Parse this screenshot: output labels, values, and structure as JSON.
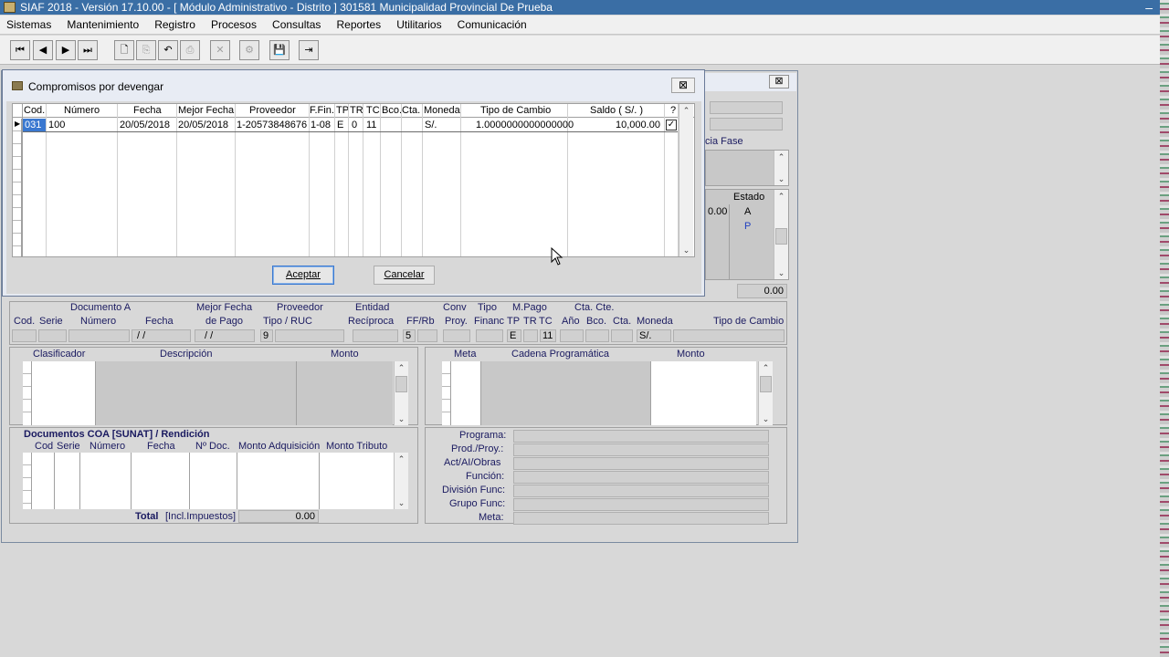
{
  "titlebar": {
    "title": "SIAF 2018 - Versión 17.10.00 - [ Módulo Administrativo - Distrito ] 301581 Municipalidad Provincial De Prueba"
  },
  "menu": [
    "Sistemas",
    "Mantenimiento",
    "Registro",
    "Procesos",
    "Consultas",
    "Reportes",
    "Utilitarios",
    "Comunicación"
  ],
  "dialog": {
    "title": "Compromisos por devengar",
    "close": "⊠",
    "columns": [
      "Cod.",
      "Número",
      "Fecha",
      "Mejor Fecha",
      "Proveedor",
      "F.Fin.",
      "TP",
      "TR",
      "TC",
      "Bco.",
      "Cta.",
      "Moneda",
      "Tipo de Cambio",
      "Saldo ( S/. )",
      "?"
    ],
    "row": {
      "cod": "031",
      "numero": "100",
      "fecha": "20/05/2018",
      "mejor_fecha": "20/05/2018",
      "proveedor": "1-20573848676",
      "ffin": "1-08",
      "tp": "E",
      "tr": "0",
      "tc": "11",
      "bco": "",
      "cta": "",
      "moneda": "S/.",
      "tipo_cambio": "1.0000000000000000",
      "saldo": "10,000.00",
      "checked": true
    },
    "accept": "Aceptar",
    "cancel": "Cancelar"
  },
  "main": {
    "close": "⊠",
    "fase_label": "cia Fase",
    "estado_label": "Estado",
    "estado_val1": "A",
    "estado_val2": "P",
    "amount_small": "0.00",
    "total_right": "0.00",
    "doc_group": "Documento A",
    "doc_cod": "Cod.",
    "doc_serie": "Serie",
    "doc_numero": "Número",
    "doc_fecha": "Fecha",
    "doc_fecha_val": "/ /",
    "mejor_fecha1": "Mejor Fecha",
    "mejor_fecha2": "de Pago",
    "mejor_fecha_val": "/ /",
    "proveedor_group": "Proveedor",
    "tipo_ruc": "Tipo / RUC",
    "tipo_val": "9",
    "entidad_group": "Entidad",
    "reciproca": "Recíproca",
    "ffrb": "FF/Rb",
    "ffrb_val": "5",
    "conv1": "Conv",
    "conv2": "Proy.",
    "tipo1": "Tipo",
    "tipo2": "Financ",
    "mpago_group": "M.Pago",
    "tp": "TP",
    "tr": "TR",
    "tc": "TC",
    "tp_val": "E",
    "tc_val": "11",
    "ctacte_group": "Cta. Cte.",
    "anio": "Año",
    "bco": "Bco.",
    "cta": "Cta.",
    "moneda": "Moneda",
    "moneda_val": "S/.",
    "tipo_cambio": "Tipo de Cambio",
    "clasificador": "Clasificador",
    "descripcion": "Descripción",
    "monto": "Monto",
    "meta": "Meta",
    "cadena": "Cadena Programática",
    "monto2": "Monto",
    "coa_title": "Documentos COA [SUNAT] / Rendición",
    "coa_cod": "Cod",
    "coa_serie": "Serie",
    "coa_numero": "Número",
    "coa_fecha": "Fecha",
    "coa_ndoc": "Nº Doc.",
    "coa_madq": "Monto Adquisición",
    "coa_mtrib": "Monto Tributo",
    "total_label": "Total",
    "total_sub": "[Incl.Impuestos]",
    "total_val": "0.00",
    "programa": "Programa:",
    "prod": "Prod./Proy.:",
    "act": "Act/AI/Obras",
    "funcion": "Función:",
    "division": "División Func:",
    "grupo": "Grupo Func:",
    "meta_lbl": "Meta:"
  },
  "icons": {
    "first": "⏮",
    "prev": "◀",
    "next": "▶",
    "last": "⏭",
    "new": "🗋",
    "copy": "⎘",
    "undo": "↶",
    "print": "⎙",
    "delete": "✕",
    "tool": "⚙",
    "save": "💾",
    "exit": "⇥"
  }
}
